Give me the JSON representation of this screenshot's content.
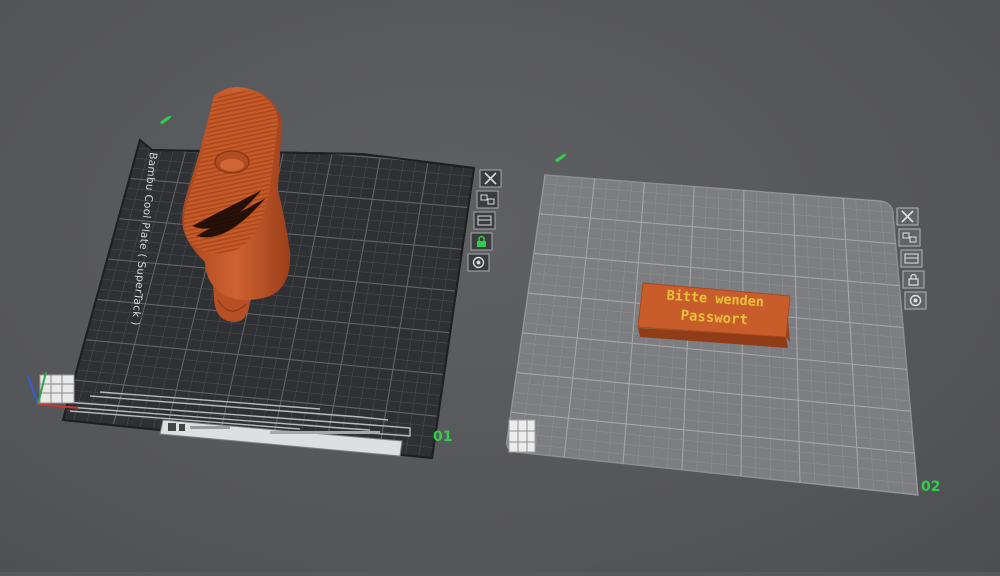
{
  "app": {
    "view": "Prepare"
  },
  "plates": [
    {
      "number": "01",
      "plate_type_label": "Bambu Cool Plate ( SuperTack )",
      "selected": true,
      "tools": [
        "close-plate",
        "arrange-plate",
        "orient-plate",
        "lock-plate",
        "plate-settings"
      ]
    },
    {
      "number": "02",
      "plate_type_label": "",
      "selected": false,
      "tools": [
        "close-plate",
        "arrange-plate",
        "orient-plate",
        "lock-plate",
        "plate-settings"
      ]
    }
  ],
  "model_label": {
    "line1": "Bitte wenden",
    "line2": "Passwort"
  },
  "colors": {
    "background": "#58595c",
    "plate_dark": "#2e2f32",
    "plate_light": "#7c7d80",
    "filament": "#c4592a",
    "text_on_model": "#e8c23a",
    "plate_number": "#2fcf4a"
  }
}
